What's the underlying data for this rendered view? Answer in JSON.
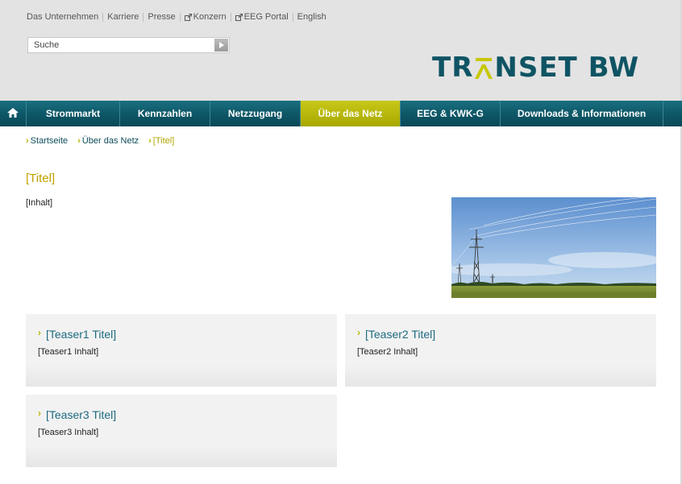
{
  "service_nav": [
    {
      "label": "Das Unternehmen",
      "external": false
    },
    {
      "label": "Karriere",
      "external": false
    },
    {
      "label": "Presse",
      "external": false
    },
    {
      "label": "Konzern",
      "external": true
    },
    {
      "label": "EEG Portal",
      "external": true
    },
    {
      "label": "English",
      "external": false
    }
  ],
  "search": {
    "placeholder": "Suche",
    "button_icon": "arrow-right-icon"
  },
  "logo": {
    "text_pre": "TR",
    "text_post": "NSET BW",
    "accent_letter_color": "#c8c800",
    "text_color": "#0f5464"
  },
  "main_nav": {
    "home_icon": "home-icon",
    "items": [
      {
        "label": "Strommarkt"
      },
      {
        "label": "Kennzahlen"
      },
      {
        "label": "Netzzugang"
      },
      {
        "label": "Über das Netz",
        "active": true
      },
      {
        "label": "EEG & KWK-G"
      },
      {
        "label": "Downloads & Informationen"
      }
    ]
  },
  "breadcrumb": [
    {
      "label": "Startseite"
    },
    {
      "label": "Über das Netz"
    },
    {
      "label": "[Titel]",
      "current": true
    }
  ],
  "page": {
    "title": "[Titel]",
    "content": "[Inhalt]"
  },
  "teasers": [
    {
      "title": "[Teaser1 Titel]",
      "body": "[Teaser1 Inhalt]"
    },
    {
      "title": "[Teaser2 Titel]",
      "body": "[Teaser2 Inhalt]"
    },
    {
      "title": "[Teaser3 Titel]",
      "body": "[Teaser3 Inhalt]"
    }
  ],
  "colors": {
    "brand_teal": "#0f5464",
    "accent_yellow": "#b6b600",
    "link_teal": "#1d6b80"
  }
}
